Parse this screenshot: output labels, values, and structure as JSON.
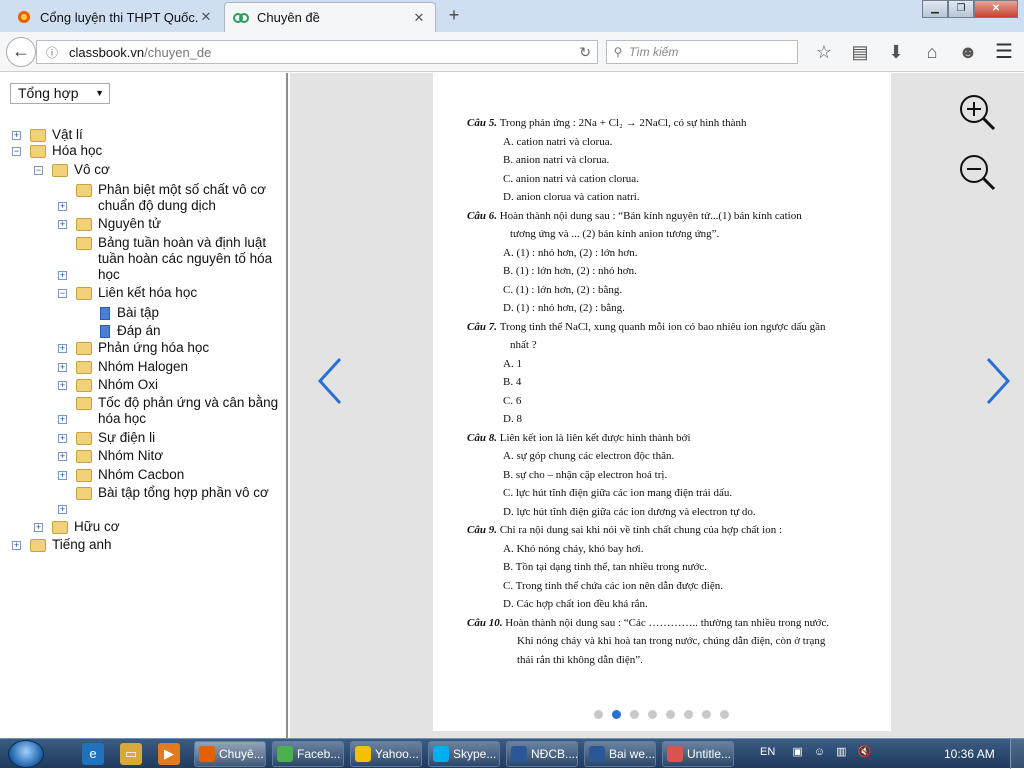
{
  "browser": {
    "tabs": [
      {
        "label": "Cổng luyện thi THPT Quốc...",
        "icon": "firefox-icon",
        "active": false
      },
      {
        "label": "Chuyên đề",
        "icon": "classbook-icon",
        "active": true
      }
    ],
    "new_tab": "+",
    "url_domain": "classbook.vn",
    "url_path": "/chuyen_de",
    "search_placeholder": "Tìm kiếm"
  },
  "sidebar": {
    "dropdown_value": "Tổng hợp",
    "tree": [
      {
        "label": "Vật lí",
        "toggle": "+"
      },
      {
        "label": "Hóa học",
        "toggle": "−"
      },
      {
        "label": "Vô cơ",
        "toggle": "−"
      },
      {
        "label": "Phân biệt một số chất vô cơ chuẩn độ dung dịch",
        "toggle": "+"
      },
      {
        "label": "Nguyên tử",
        "toggle": "+"
      },
      {
        "label": "Bảng tuần hoàn và định luật tuần hoàn các nguyên tố hóa học",
        "toggle": "+"
      },
      {
        "label": "Liên kết hóa học",
        "toggle": "−"
      },
      {
        "label": "Bài tập",
        "toggle": ""
      },
      {
        "label": "Đáp án",
        "toggle": ""
      },
      {
        "label": "Phản ứng hóa học",
        "toggle": "+"
      },
      {
        "label": "Nhóm Halogen",
        "toggle": "+"
      },
      {
        "label": "Nhóm Oxi",
        "toggle": "+"
      },
      {
        "label": "Tốc độ phản ứng và cân bằng hóa học",
        "toggle": "+"
      },
      {
        "label": "Sự điện li",
        "toggle": "+"
      },
      {
        "label": "Nhóm Nitơ",
        "toggle": "+"
      },
      {
        "label": "Nhóm Cacbon",
        "toggle": "+"
      },
      {
        "label": "Bài tập tổng hợp phần vô cơ",
        "toggle": "+"
      },
      {
        "label": "Hữu cơ",
        "toggle": "+"
      },
      {
        "label": "Tiếng anh",
        "toggle": "+"
      }
    ]
  },
  "document": {
    "lines": [
      {
        "qn": "Câu 5.",
        "text": "Trong phản ứng :  2Na  +  Cl₂ → 2NaCl, có sự hình thành"
      },
      {
        "qn": "",
        "text": "A.  cation natri và clorua."
      },
      {
        "qn": "",
        "text": "B.  anion natri và clorua."
      },
      {
        "qn": "",
        "text": "C.  anion natri và cation clorua."
      },
      {
        "qn": "",
        "text": "D.  anion clorua và cation natri."
      },
      {
        "qn": "Câu 6.",
        "text": "Hoàn thành nội dung sau : “Bán kính nguyên tử...(1) bán kính cation"
      },
      {
        "qn": "",
        "text": "tương ứng và ... (2) bán kính anion tương ứng”."
      },
      {
        "qn": "",
        "text": "A.  (1) : nhỏ hơn, (2) : lớn hơn."
      },
      {
        "qn": "",
        "text": "B.  (1) : lớn hơn, (2) : nhỏ hơn."
      },
      {
        "qn": "",
        "text": "C.  (1) : lớn hơn, (2) : bằng."
      },
      {
        "qn": "",
        "text": "D.  (1) : nhỏ hơn, (2) : bằng."
      },
      {
        "qn": "Câu 7.",
        "text": "Trong tinh thể NaCl, xung quanh mỗi ion có bao nhiêu ion ngược dấu gần"
      },
      {
        "qn": "",
        "text": "nhất ?"
      },
      {
        "qn": "",
        "text": "A.  1"
      },
      {
        "qn": "",
        "text": "B.  4"
      },
      {
        "qn": "",
        "text": "C.  6"
      },
      {
        "qn": "",
        "text": "D.  8"
      },
      {
        "qn": "Câu 8.",
        "text": "Liên kết ion là liên kết được hình thành bởi"
      },
      {
        "qn": "",
        "text": "A.  sự góp chung các electron độc thân."
      },
      {
        "qn": "",
        "text": "B.  sự cho – nhận cặp electron hoá trị."
      },
      {
        "qn": "",
        "text": "C.  lực hút tĩnh điện giữa các ion mang điện trái dấu."
      },
      {
        "qn": "",
        "text": "D.  lực hút tĩnh điện giữa các ion dương và electron tự do."
      },
      {
        "qn": "Câu 9.",
        "text": "Chỉ ra nội dung sai khi nói về tính chất chung của hợp chất ion :"
      },
      {
        "qn": "",
        "text": "A.  Khó nóng chảy, khó bay hơi."
      },
      {
        "qn": "",
        "text": "B.  Tồn tại dạng tinh thể, tan nhiều trong nước."
      },
      {
        "qn": "",
        "text": "C.  Trong tinh thể chứa các ion nên dẫn được điện."
      },
      {
        "qn": "",
        "text": "D.  Các hợp chất ion đều khá rắn."
      },
      {
        "qn": "Câu 10.",
        "text": "Hoàn thành nội dung sau : “Các ………….. thường tan nhiều trong nước."
      },
      {
        "qn": "",
        "text": "Khi nóng chảy và khi hoà tan trong nước, chúng dẫn điện, còn ở trạng"
      },
      {
        "qn": "",
        "text": "thái rắn thì không dẫn điện”."
      }
    ],
    "pages_total": 8,
    "page_active": 2
  },
  "taskbar": {
    "buttons": [
      {
        "label": "Chuyê...",
        "icon": "firefox-icon",
        "color": "#e66000"
      },
      {
        "label": "Faceb...",
        "icon": "chrome-icon",
        "color": "#4caf50"
      },
      {
        "label": "Yahoo...",
        "icon": "yahoo-icon",
        "color": "#f2c200"
      },
      {
        "label": "Skype...",
        "icon": "skype-icon",
        "color": "#00aff0"
      },
      {
        "label": "NĐCB....",
        "icon": "word-icon",
        "color": "#2b5797"
      },
      {
        "label": "Bai we...",
        "icon": "word-icon",
        "color": "#2b5797"
      },
      {
        "label": "Untitle...",
        "icon": "paint-icon",
        "color": "#d9534f"
      }
    ],
    "language": "EN",
    "clock": "10:36 AM"
  }
}
